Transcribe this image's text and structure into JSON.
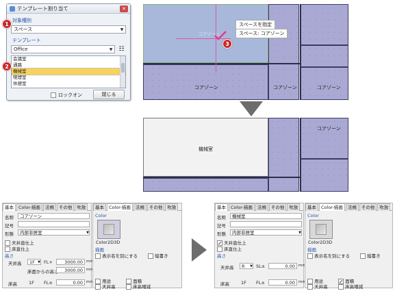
{
  "dialog": {
    "title": "テンプレート割り当て",
    "target_group": "対象種別",
    "target_value": "スペース",
    "template_group": "テンプレート",
    "template_combo": "Office",
    "list_items": [
      "会議室",
      "通路",
      "機械室",
      "喫煙室",
      "休憩室"
    ],
    "selected_index": 2,
    "lock_label": "ロックオン",
    "close_label": "閉じる"
  },
  "badges": [
    "1",
    "2",
    "3"
  ],
  "plan_top": {
    "tooltip_title": "スペースを指定",
    "tooltip_value": "スペース: コアゾーン",
    "cursor_label": "コアゾーン",
    "zones": [
      "コアゾーン",
      "コアゾーン",
      "コアゾーン",
      "コアゾーン"
    ]
  },
  "plan_bottom": {
    "room": "機械室",
    "zones": [
      "コアゾーン",
      "コアゾーン"
    ]
  },
  "panel_left": {
    "tabs": [
      "基本",
      "Color-描画",
      "法規",
      "その他",
      "吹放"
    ],
    "name_label": "名称",
    "name_value": "コアゾーン",
    "symbol_label": "記号",
    "form_label": "形態",
    "form_value": "内部非居室",
    "ceiling_label": "天井直仕上",
    "floor_label": "床直仕上",
    "height_section": "高さ",
    "ceiling_height_label": "天井高",
    "ceiling_height_level": "1F",
    "ceiling_height_ref": "FL+",
    "ceiling_height_value": "3000.00",
    "unit": "mm",
    "floor_to_height_label": "床面からの高さ",
    "floor_to_height_value": "3000.00",
    "floor_height_label": "床高",
    "floor_height_level": "1F",
    "floor_height_ref": "FL±",
    "floor_height_value": "0.00"
  },
  "panel_left_color": {
    "tabs": [
      "基本",
      "Color-描画",
      "法規",
      "その他",
      "吹放"
    ],
    "color_section": "Color",
    "swatch_label": "Color2D3D",
    "draw_section": "描画",
    "show_name_label": "表示名を別にする",
    "vertical_label": "縦書き",
    "checks": [
      "用途",
      "天井高",
      "面積",
      "床高増減"
    ]
  },
  "panel_right": {
    "tabs": [
      "基本",
      "Color-描画",
      "法規",
      "その他",
      "吹放"
    ],
    "name_label": "名称",
    "name_value": "機械室",
    "symbol_label": "記号",
    "form_label": "形態",
    "form_value": "内部非居室",
    "ceiling_label": "天井直仕上",
    "floor_label": "床直仕上",
    "height_section": "高さ",
    "ceiling_height_label": "天井高",
    "ceiling_height_level": "R",
    "ceiling_height_ref": "SL±",
    "ceiling_height_value": "0.00",
    "unit": "mm",
    "floor_height_label": "床高",
    "floor_height_level": "1F",
    "floor_height_ref": "FL±",
    "floor_height_value": "0.00"
  },
  "panel_right_color": {
    "tabs": [
      "基本",
      "Color-描画",
      "法規",
      "その他",
      "吹放"
    ],
    "color_section": "Color",
    "swatch_label": "Color2D3D",
    "draw_section": "描画",
    "show_name_label": "表示名を別にする",
    "vertical_label": "縦書き",
    "checks": [
      "用途",
      "天井高",
      "面積",
      "床高増減"
    ]
  },
  "colors": {
    "badge": "#c8282a",
    "zone": "#a9a9d4",
    "selected_item": "#f7d35b",
    "arrow": "#6d6d6d"
  }
}
